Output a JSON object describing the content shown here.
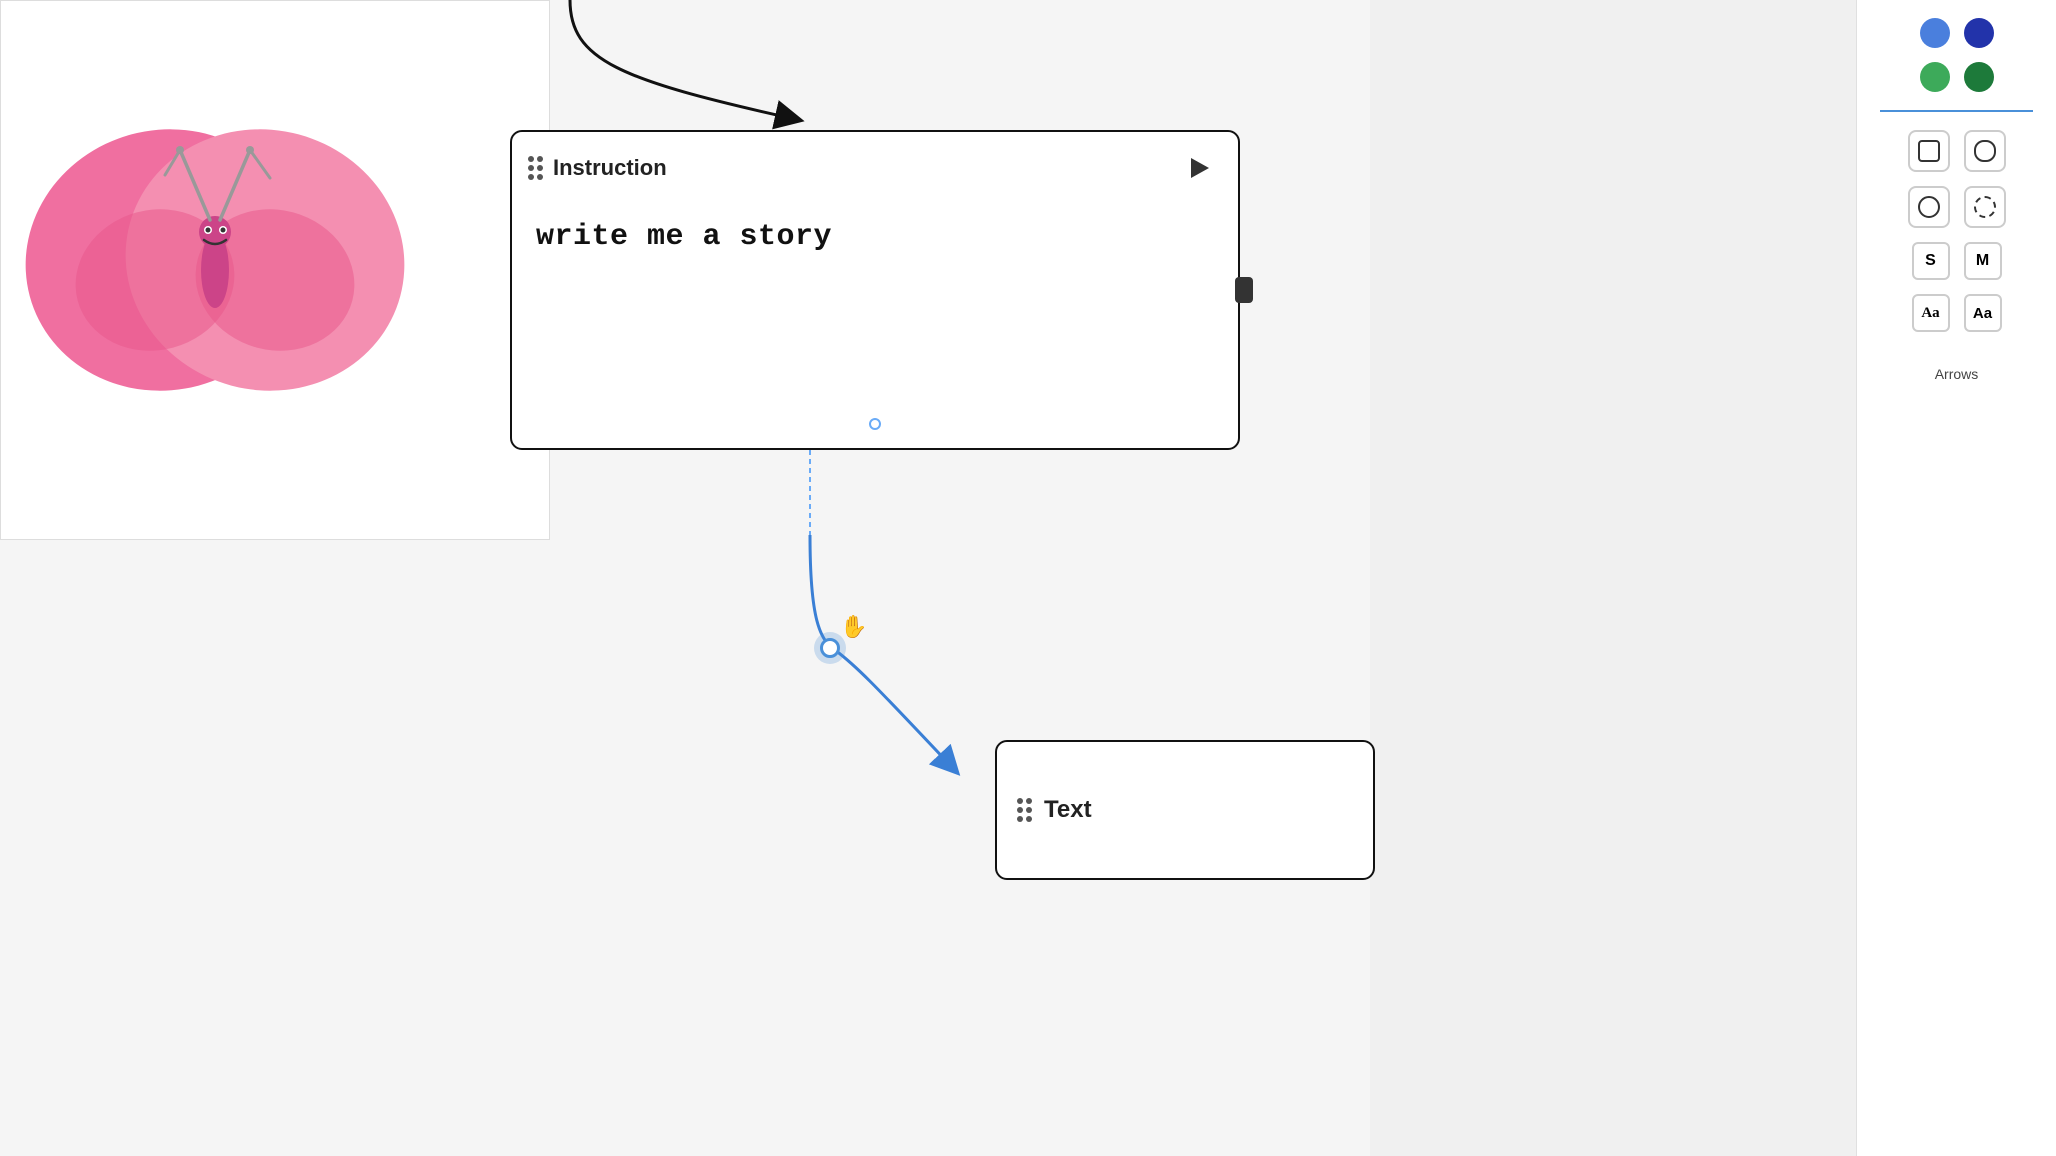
{
  "canvas": {
    "background": "#f5f5f5"
  },
  "instruction_card": {
    "title": "Instruction",
    "body_text": "write me a story",
    "play_button_label": "Play"
  },
  "text_card": {
    "title": "Text"
  },
  "right_panel": {
    "colors": [
      {
        "name": "blue",
        "hex": "#4a7fdd"
      },
      {
        "name": "dark-blue",
        "hex": "#3355cc"
      },
      {
        "name": "green",
        "hex": "#3daa5a"
      },
      {
        "name": "dark-green",
        "hex": "#2d8849"
      }
    ],
    "shape_buttons": [
      "square",
      "rounded-square",
      "circle",
      "dashed-circle"
    ],
    "size_buttons": [
      "S",
      "M"
    ],
    "font_buttons": [
      "Aa-serif",
      "Aa-sans"
    ],
    "arrows_label": "Arrows"
  },
  "arrow_top": {
    "description": "Black curved arrow from top going into instruction card"
  },
  "arrow_bottom": {
    "description": "Blue curved arrow from instruction card going to text card"
  }
}
